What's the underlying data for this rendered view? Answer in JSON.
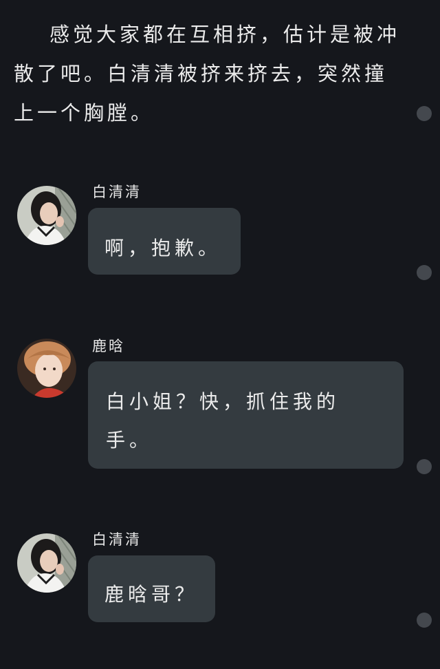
{
  "narration": {
    "text": "感觉大家都在互相挤，估计是被冲散了吧。白清清被挤来挤去，突然撞上一个胸膛。"
  },
  "messages": [
    {
      "sender": "白清清",
      "text": "啊，抱歉。",
      "avatar": "girl-avatar"
    },
    {
      "sender": "鹿晗",
      "text": "白小姐？快，抓住我的手。",
      "avatar": "boy-avatar"
    },
    {
      "sender": "白清清",
      "text": "鹿晗哥？",
      "avatar": "girl-avatar"
    }
  ],
  "colors": {
    "background": "#15171c",
    "bubble": "#343b40",
    "dot": "#44484e"
  }
}
